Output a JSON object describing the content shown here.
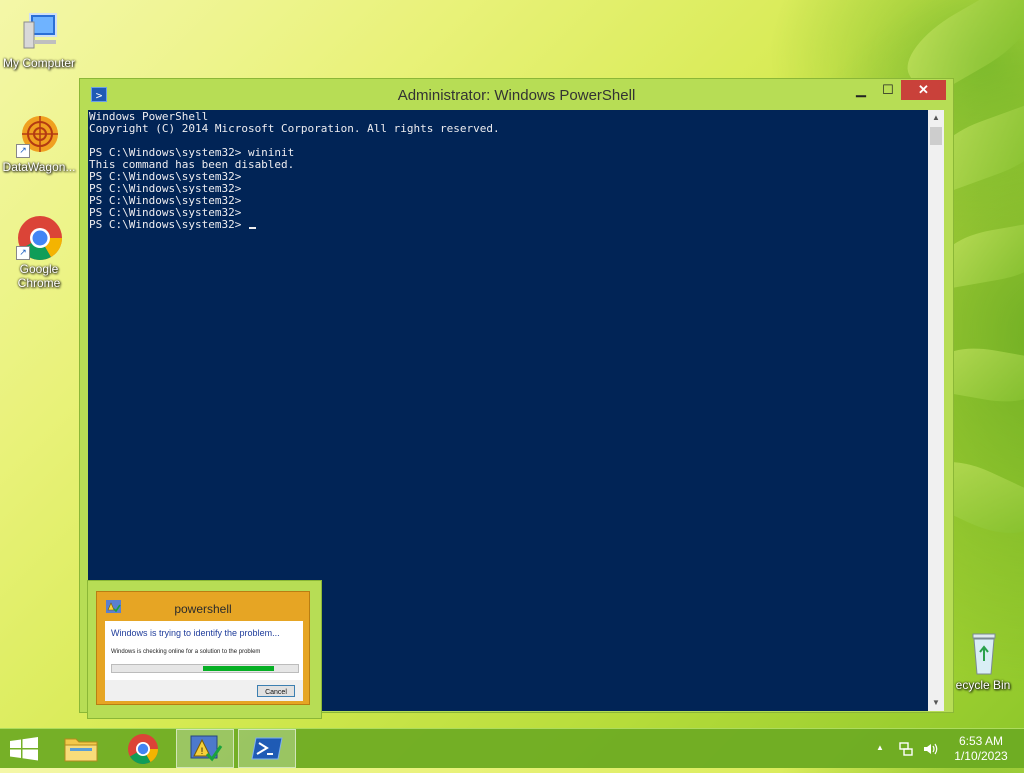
{
  "desktop": {
    "icons": [
      {
        "label": "My Computer",
        "icon": "computer-icon"
      },
      {
        "label": "DataWagon...",
        "icon": "datawagon-icon"
      },
      {
        "label": "Google Chrome",
        "icon": "chrome-icon"
      },
      {
        "label": "ecycle Bin",
        "icon": "recycle-bin-icon"
      }
    ]
  },
  "window": {
    "title": "Administrator: Windows PowerShell",
    "app_icon": "powershell-icon",
    "min_glyph": "▁",
    "max_glyph": "☐",
    "close_glyph": "✕",
    "console_background": "#012456",
    "console_lines": [
      "Windows PowerShell",
      "Copyright (C) 2014 Microsoft Corporation. All rights reserved.",
      "",
      "PS C:\\Windows\\system32> wininit",
      "This command has been disabled.",
      "PS C:\\Windows\\system32>",
      "PS C:\\Windows\\system32>",
      "PS C:\\Windows\\system32>",
      "PS C:\\Windows\\system32>",
      "PS C:\\Windows\\system32> "
    ],
    "scroll_up_glyph": "▲",
    "scroll_down_glyph": "▼"
  },
  "error_dialog": {
    "title": "powershell",
    "heading": "Windows is trying to identify the problem...",
    "subtext": "Windows is checking online for a solution to the problem",
    "progress_start": 0.49,
    "progress_end": 0.87,
    "progress_color": "#06b025",
    "cancel_label": "Cancel"
  },
  "taskbar": {
    "items": [
      {
        "name": "start-button",
        "icon": "windows-logo-icon",
        "active": false
      },
      {
        "name": "file-explorer",
        "icon": "folder-icon",
        "active": false
      },
      {
        "name": "chrome",
        "icon": "chrome-icon",
        "active": false
      },
      {
        "name": "problem-reporting",
        "icon": "problem-reporting-icon",
        "active": true
      },
      {
        "name": "powershell",
        "icon": "powershell-icon",
        "active": true
      }
    ],
    "tray": {
      "chevron": "▲",
      "network_icon": "network-icon",
      "volume_icon": "volume-icon"
    },
    "clock_time": "6:53 AM",
    "clock_date": "1/10/2023"
  },
  "colors": {
    "accent": "#b7dd55",
    "close_button": "#c9413a",
    "dialog_frame": "#e6a524"
  }
}
